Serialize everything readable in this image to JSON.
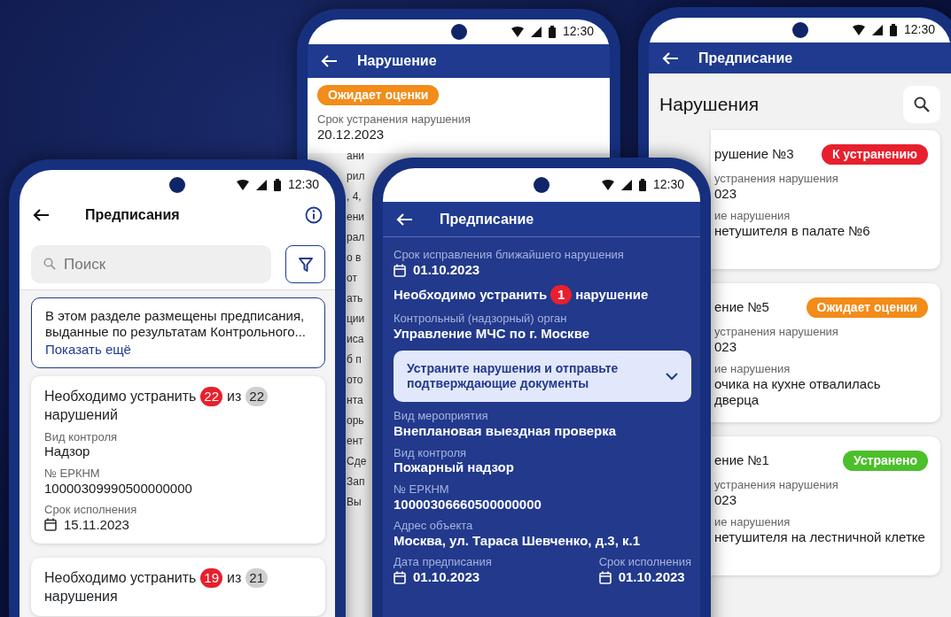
{
  "phones": [
    {
      "kind": "violation",
      "status_time": "12:30",
      "title": "Нарушение",
      "card": {
        "badge": {
          "label": "Ожидает оценки",
          "color": "#f28c1a"
        },
        "label": "Срок устранения нарушения",
        "value": "20.12.2023"
      },
      "fragments": [
        "ани",
        "рил",
        ", 4,",
        "ени",
        "рал",
        "о в",
        "от",
        "ать",
        "ции",
        "иса",
        "б п",
        "ото",
        "нта",
        "орь",
        "ент",
        "Сде",
        "Зап",
        "Вы"
      ]
    },
    {
      "kind": "violations_list",
      "status_time": "12:30",
      "title": "Предписание",
      "heading": "Нарушения",
      "items": [
        {
          "title": "рушение №3",
          "badge": {
            "label": "К устранению",
            "color": "#e8202e"
          },
          "date_label": "устранения нарушения",
          "date": "023",
          "desc_label": "ие нарушения",
          "desc": "нетушителя в палате №6"
        },
        {
          "title": "ение №5",
          "badge": {
            "label": "Ожидает оценки",
            "color": "#f28c1a"
          },
          "date_label": "устранения нарушения",
          "date": "023",
          "desc_label": "ие нарушения",
          "desc": "очика на кухне отвалилась дверца"
        },
        {
          "title": "ение №1",
          "badge": {
            "label": "Устранено",
            "color": "#4cbf2a"
          },
          "date_label": "устранения нарушения",
          "date": "023",
          "desc_label": "ие нарушения",
          "desc": "нетушителя на лестничной клетке"
        }
      ]
    },
    {
      "kind": "orders_list",
      "status_time": "12:30",
      "title": "Предписания",
      "search": {
        "placeholder": "Поиск"
      },
      "info": {
        "text": "В этом разделе размещены предписания, выданные по результатам Контрольного...",
        "link": "Показать ещё"
      },
      "cards": [
        {
          "prefix": "Необходимо устранить",
          "open": "22",
          "of": "из",
          "total": "22",
          "suffix": "нарушений",
          "fields": [
            {
              "label": "Вид контроля",
              "value": "Надзор"
            },
            {
              "label": "№ ЕРКНМ",
              "value": "10000309990500000000"
            },
            {
              "label": "Срок исполнения",
              "value": "15.11.2023",
              "kind": "date"
            }
          ]
        },
        {
          "prefix": "Необходимо устранить",
          "open": "19",
          "of": "из",
          "total": "21",
          "suffix": "нарушения"
        }
      ]
    },
    {
      "kind": "order_detail",
      "status_time": "12:30",
      "title": "Предписание",
      "deadline": {
        "label": "Срок исправления ближайшего нарушения",
        "value": "01.10.2023"
      },
      "count": {
        "prefix": "Необходимо устранить",
        "open": "1",
        "suffix": "нарушение"
      },
      "authority": {
        "label": "Контрольный (надзорный) орган",
        "value": "Управление МЧС по г. Москве"
      },
      "action": {
        "text": "Устраните нарушения и отправьте подтверждающие документы",
        "expanded": false
      },
      "fields": [
        {
          "label": "Вид мероприятия",
          "value": "Внеплановая выездная проверка"
        },
        {
          "label": "Вид контроля",
          "value": "Пожарный надзор"
        },
        {
          "label": "№ ЕРКНМ",
          "value": "10000306660500000000"
        },
        {
          "label": "Адрес объекта",
          "value": "Москва, ул. Тараса Шевченко, д.3, к.1"
        }
      ],
      "dates": [
        {
          "label": "Дата предписания",
          "value": "01.10.2023"
        },
        {
          "label": "Срок исполнения",
          "value": "01.10.2023"
        }
      ]
    }
  ]
}
